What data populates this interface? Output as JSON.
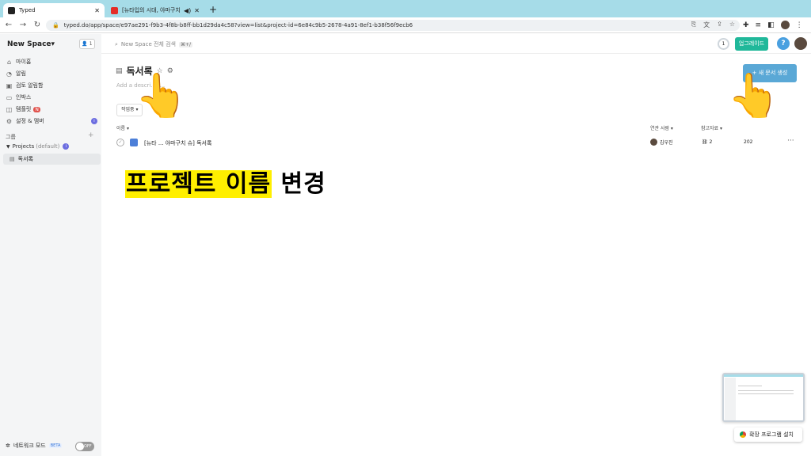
{
  "browser": {
    "tabs": [
      {
        "label": "Typed",
        "favicon": "typed-icon",
        "active": true
      },
      {
        "label": "[뉴타입의 시대, 야마구치 슈 저",
        "favicon": "youtube-icon",
        "active": false
      }
    ],
    "url": "typed.do/app/space/e97ae291-f9b3-4f8b-b8ff-bb1d29da4c58?view=list&project-id=6e84c9b5-2678-4a91-8ef1-b38f56f9ecb6"
  },
  "sidebar": {
    "space_name": "New Space",
    "member_count": "1",
    "items": [
      {
        "label": "마이홈",
        "icon": "home-icon"
      },
      {
        "label": "알림",
        "icon": "bell-icon"
      },
      {
        "label": "검토 알림함",
        "icon": "review-icon"
      },
      {
        "label": "인박스",
        "icon": "inbox-icon"
      },
      {
        "label": "템플릿",
        "icon": "template-icon",
        "badge": "N"
      },
      {
        "label": "설정 & 멤버",
        "icon": "gear-icon"
      }
    ],
    "group_label": "그룹",
    "project": {
      "name": "Projects",
      "tag": "(default)"
    },
    "doc_item": "독서록",
    "network_mode": "네트워크 모드",
    "beta": "BETA",
    "toggle": "OFF"
  },
  "topbar": {
    "search_placeholder": "New Space 전체 검색",
    "shortcut": "⌘+/",
    "notif_count": "1",
    "upgrade": "업그레이드",
    "help": "?"
  },
  "page": {
    "title": "독서록",
    "description_placeholder": "Add a descri...n...",
    "new_doc_button": "+ 새 문서 생성",
    "filter": "작업중 ▾",
    "columns": {
      "name": "이름 ▾",
      "user": "연관 사람 ▾",
      "refs": "참고자료 ▾"
    },
    "rows": [
      {
        "title": "[뉴타 ... 야마구치 슈] 독서록",
        "user": "김우진",
        "refs": "2",
        "date": "202"
      }
    ]
  },
  "caption": {
    "highlight": "프로젝트 이름",
    "rest": " 변경"
  },
  "install_extension": "확장 프로그램 설치"
}
